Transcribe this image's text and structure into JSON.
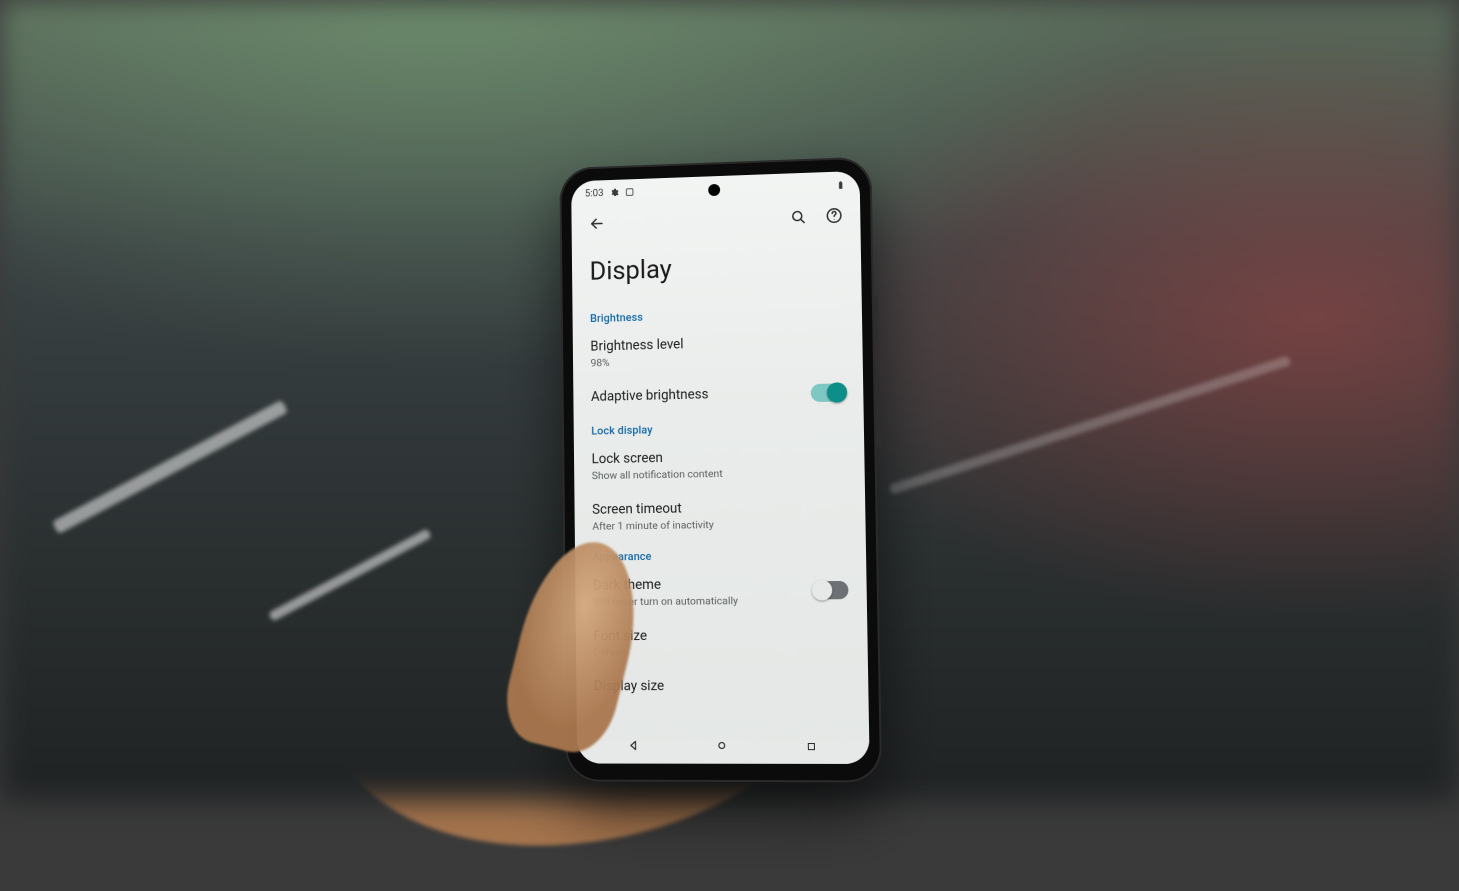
{
  "status": {
    "time": "5:03",
    "battery_icon": "battery"
  },
  "appbar": {
    "back_icon": "arrow-back",
    "search_icon": "search",
    "help_icon": "help"
  },
  "page": {
    "title": "Display"
  },
  "sections": {
    "brightness": {
      "header": "Brightness",
      "level": {
        "title": "Brightness level",
        "sub": "98%"
      },
      "adaptive": {
        "title": "Adaptive brightness",
        "on": true
      }
    },
    "lock_display": {
      "header": "Lock display",
      "lock_screen": {
        "title": "Lock screen",
        "sub": "Show all notification content"
      },
      "timeout": {
        "title": "Screen timeout",
        "sub": "After 1 minute of inactivity"
      }
    },
    "appearance": {
      "header": "Appearance",
      "dark_theme": {
        "title": "Dark theme",
        "sub": "Will never turn on automatically",
        "on": false
      },
      "font_size": {
        "title": "Font size",
        "sub": "Default"
      },
      "display_size": {
        "title": "Display size"
      }
    }
  },
  "nav": {
    "back": "back",
    "home": "home",
    "recents": "recents"
  },
  "colors": {
    "accent": "#0d8e89",
    "section_header": "#1168a8"
  }
}
